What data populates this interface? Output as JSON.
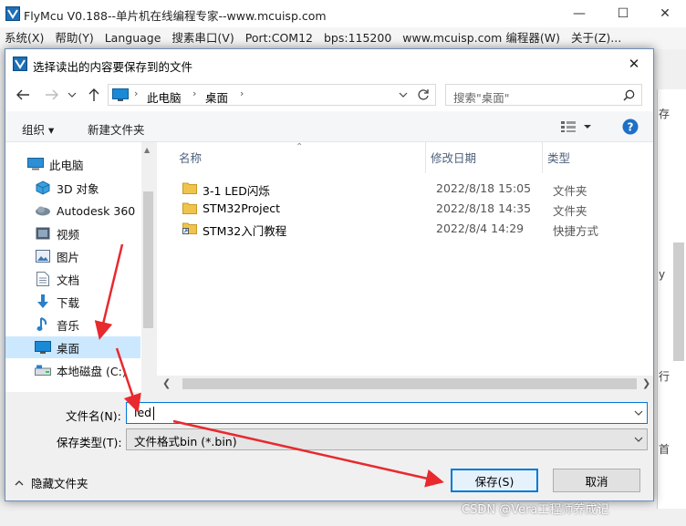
{
  "app": {
    "title": "FlyMcu V0.188--单片机在线编程专家--www.mcuisp.com",
    "menu": [
      "系统(X)",
      "帮助(Y)",
      "Language",
      "搜素串口(V)",
      "Port:COM12",
      "bps:115200",
      "www.mcuisp.com 编程器(W)",
      "关于(Z)..."
    ],
    "fragments": [
      "存",
      "y",
      "行",
      "首"
    ]
  },
  "dialog": {
    "title": "选择读出的内容要保存到的文件",
    "breadcrumb": [
      "此电脑",
      "桌面"
    ],
    "search_placeholder": "搜索\"桌面\"",
    "toolbar": {
      "organize": "组织 ▾",
      "new_folder": "新建文件夹"
    },
    "nav_items": [
      {
        "label": "此电脑",
        "icon": "computer-icon"
      },
      {
        "label": "3D 对象",
        "icon": "cube-icon"
      },
      {
        "label": "Autodesk 360",
        "icon": "cloud-icon"
      },
      {
        "label": "视频",
        "icon": "video-icon"
      },
      {
        "label": "图片",
        "icon": "picture-icon"
      },
      {
        "label": "文档",
        "icon": "document-icon"
      },
      {
        "label": "下载",
        "icon": "download-icon"
      },
      {
        "label": "音乐",
        "icon": "music-icon"
      },
      {
        "label": "桌面",
        "icon": "desktop-icon",
        "selected": true
      },
      {
        "label": "本地磁盘 (C:)",
        "icon": "drive-icon"
      }
    ],
    "columns": {
      "name": "名称",
      "date": "修改日期",
      "type": "类型"
    },
    "files": [
      {
        "name": "3-1 LED闪烁",
        "date": "2022/8/18 15:05",
        "type": "文件夹",
        "icon": "folder-icon"
      },
      {
        "name": "STM32Project",
        "date": "2022/8/18 14:35",
        "type": "文件夹",
        "icon": "folder-icon"
      },
      {
        "name": "STM32入门教程",
        "date": "2022/8/4 14:29",
        "type": "快捷方式",
        "icon": "shortcut-folder-icon"
      }
    ],
    "filename_label": "文件名(N):",
    "filename_value": "led",
    "filetype_label": "保存类型(T):",
    "filetype_value": "文件格式bin (*.bin)",
    "hide_folders": "隐藏文件夹",
    "save_label": "保存(S)",
    "cancel_label": "取消"
  },
  "watermark": "CSDN @Vera工程师养成记",
  "colors": {
    "accent": "#0078d7",
    "arrow": "#e8292e",
    "folder": "#f0c44c",
    "selected": "#cce8ff"
  }
}
